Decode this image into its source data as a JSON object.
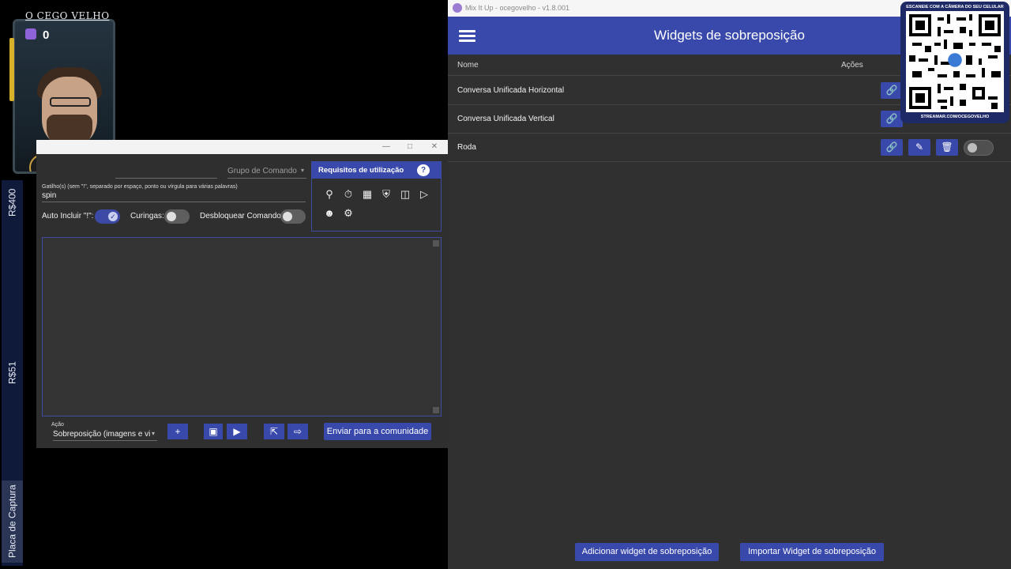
{
  "overlay_left": {
    "donation_400": "R$400",
    "donation_51": "R$51",
    "capture_label": "Placa de Captura"
  },
  "webcam": {
    "channel_name": "O CEGO VELHO",
    "viewer_count": "0"
  },
  "command_window": {
    "group_label": "Grupo de Comando",
    "triggers_label": "Gatilho(s) (sem \"!\", separado por espaço, ponto ou vírgula para várias palavras)",
    "triggers_value": "spin",
    "auto_include_label": "Auto Incluir \"!\":",
    "wildcards_label": "Curingas:",
    "unlock_label": "Desbloquear Comando:",
    "requirements_title": "Requisitos de utilização",
    "requirements_help": "?",
    "action_label": "Ação",
    "action_value": "Sobreposição (imagens e vi",
    "add_label": "+",
    "send_community_label": "Enviar para a comunidade",
    "toggles": {
      "auto_include": true,
      "wildcards": false,
      "unlock": false
    }
  },
  "mixitup": {
    "window_title": "Mix It Up - ocegovelho - v1.8.001",
    "page_title": "Widgets de sobreposição",
    "col_name": "Nome",
    "col_actions": "Ações",
    "rows": [
      {
        "name": "Conversa Unificada Horizontal"
      },
      {
        "name": "Conversa Unificada Vertical"
      },
      {
        "name": "Roda"
      }
    ],
    "add_widget_label": "Adicionar widget de sobreposição",
    "import_widget_label": "Importar Widget de sobreposição"
  },
  "qr_overlay": {
    "top_text": "ESCANEIE COM A CÂMERA DO SEU CELULAR",
    "bottom_text": "STREAMAR.COM/OCEGOVELHO"
  },
  "colors": {
    "accent": "#3949ab",
    "window_bg": "#303030"
  }
}
